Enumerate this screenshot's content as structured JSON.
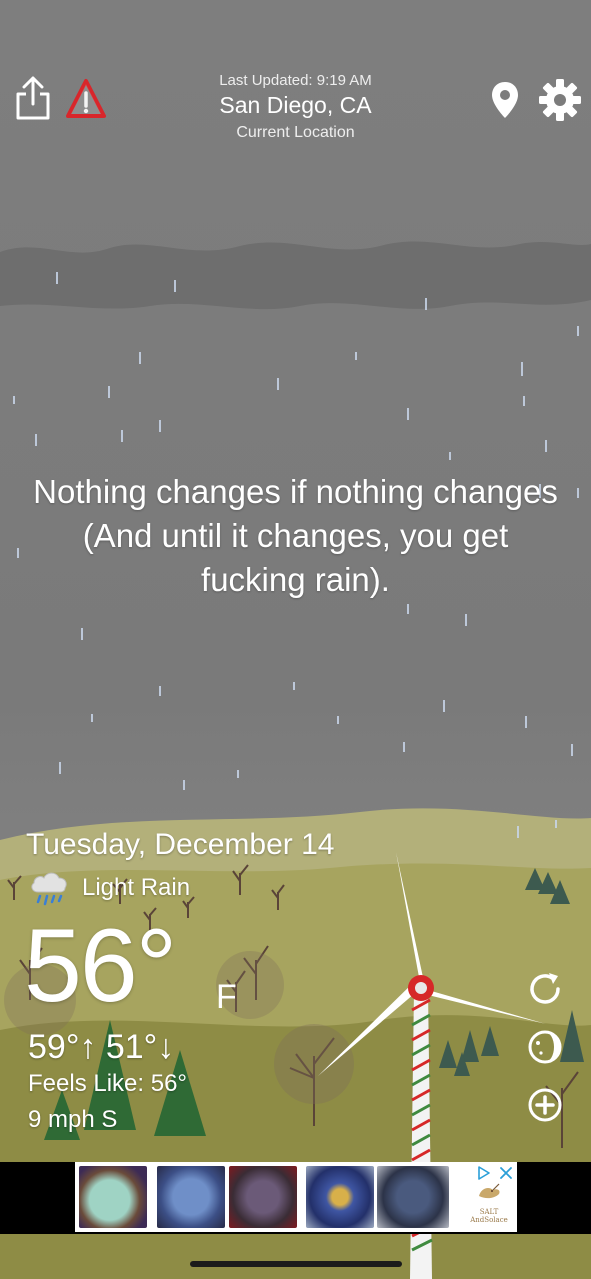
{
  "header": {
    "last_updated": "Last Updated: 9:19 AM",
    "location": "San Diego, CA",
    "location_sub": "Current Location",
    "icons": [
      "share-icon",
      "weather-alert-icon",
      "location-pin-icon",
      "gear-icon"
    ]
  },
  "quote": "Nothing changes if nothing changes (And until it changes, you get fucking rain).",
  "weather": {
    "date": "Tuesday, December 14",
    "condition": "Light Rain",
    "condition_icon": "rain-cloud-icon",
    "temperature": "56°",
    "unit": "F",
    "hilo": "59°↑ 51°↓",
    "feels_like": "Feels Like: 56°",
    "wind": "9 mph S"
  },
  "side_actions": [
    "refresh-icon",
    "moon-phase-icon",
    "add-icon"
  ],
  "ad": {
    "thumbnails": 5,
    "logo_text": "SALT\nAndSolace"
  },
  "colors": {
    "sky": "#7c7c7c",
    "cloud": "#6f6f6f",
    "hills": "#9c9a52",
    "alert_red": "#d8262b",
    "turbine_red": "#d62828"
  }
}
